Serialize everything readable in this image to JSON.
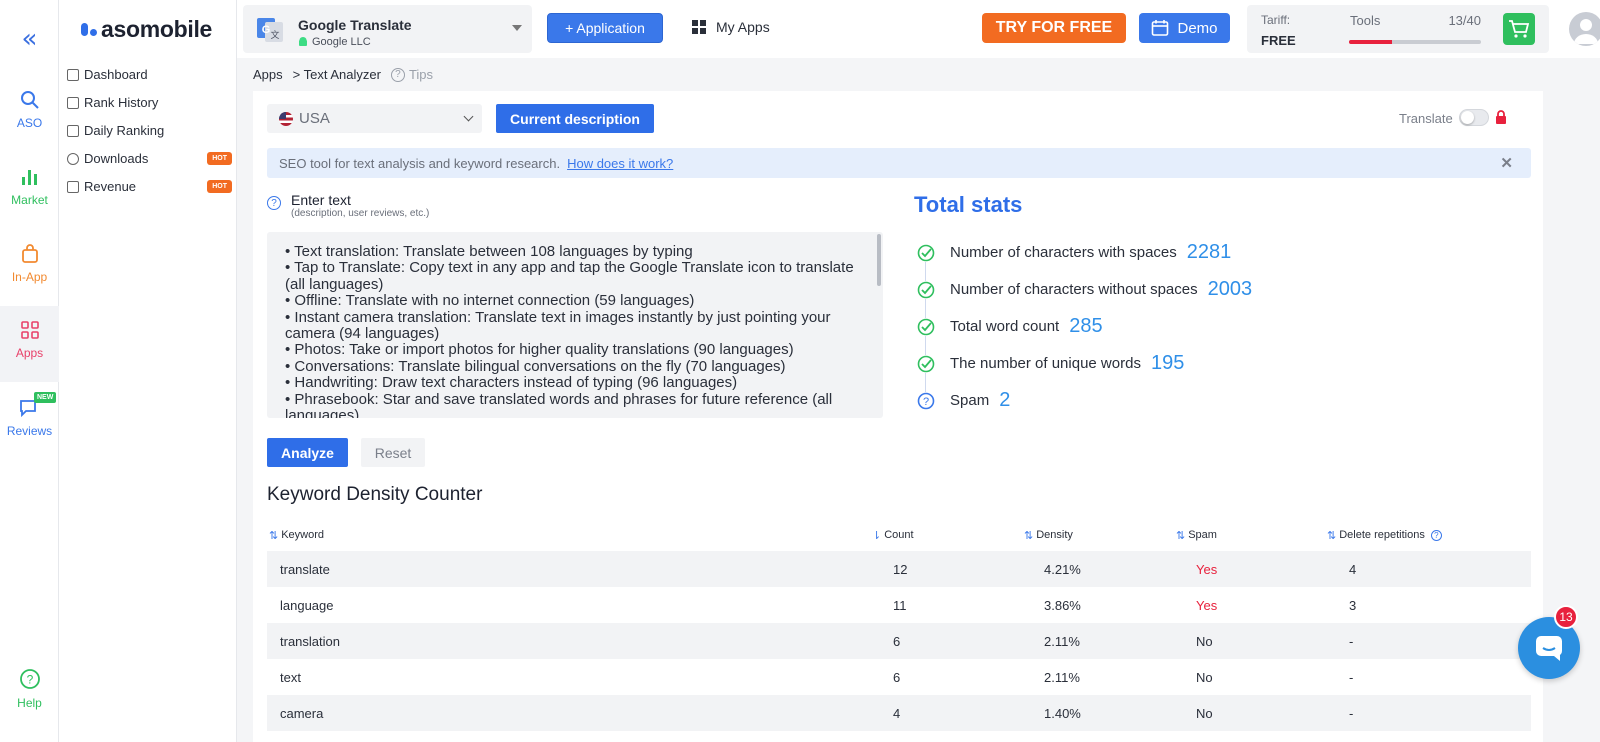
{
  "rail": {
    "items": [
      {
        "label": "ASO",
        "icon": "search-icon",
        "color": "#3a78ea"
      },
      {
        "label": "Market",
        "icon": "bar-chart-icon",
        "color": "#2fbf5e"
      },
      {
        "label": "In-App",
        "icon": "shopping-bag-icon",
        "color": "#f28a30"
      },
      {
        "label": "Apps",
        "icon": "apps-grid-icon",
        "color": "#e8416a"
      },
      {
        "label": "Reviews",
        "icon": "chat-icon",
        "color": "#3a78ea",
        "badge": "NEW"
      }
    ],
    "help": "Help"
  },
  "brand": {
    "name": "asomobile"
  },
  "menu": {
    "items": [
      {
        "label": "Dashboard",
        "icon": "dashboard-icon"
      },
      {
        "label": "Rank History",
        "icon": "rank-history-icon"
      },
      {
        "label": "Daily Ranking",
        "icon": "daily-ranking-icon"
      },
      {
        "label": "Downloads",
        "icon": "downloads-icon",
        "badge": "HOT"
      },
      {
        "label": "Revenue",
        "icon": "revenue-icon",
        "badge": "HOT"
      }
    ]
  },
  "topbar": {
    "app_name": "Google Translate",
    "app_developer": "Google LLC",
    "add_app_label": "+ Application",
    "my_apps_label": "My Apps",
    "try_label": "TRY FOR FREE",
    "demo_label": "Demo",
    "tariff_label": "Tariff:",
    "tariff_value": "FREE",
    "tools_label": "Tools",
    "tools_count": "13/40",
    "tools_used": 13,
    "tools_total": 40
  },
  "breadcrumb": {
    "root": "Apps",
    "current": "> Text Analyzer",
    "tips": "Tips"
  },
  "controls": {
    "country": "USA",
    "current_description_label": "Current description",
    "translate_label": "Translate",
    "translate_on": false
  },
  "info": {
    "text": "SEO tool for text analysis and keyword research.",
    "link": "How does it work?"
  },
  "input": {
    "title": "Enter text",
    "subtitle": "(description, user reviews, etc.)",
    "lines": [
      "• Text translation: Translate between 108 languages by typing",
      "• Tap to Translate: Copy text in any app and tap the Google Translate icon to translate (all languages)",
      "• Offline: Translate with no internet connection (59 languages)",
      "• Instant camera translation: Translate text in images instantly by just pointing your camera (94 languages)",
      "• Photos: Take or import photos for higher quality translations (90 languages)",
      "• Conversations: Translate bilingual conversations on the fly (70 languages)",
      "• Handwriting: Draw text characters instead of typing (96 languages)",
      "• Phrasebook: Star and save translated words and phrases for future reference (all languages)"
    ],
    "analyze_label": "Analyze",
    "reset_label": "Reset"
  },
  "stats": {
    "title": "Total stats",
    "items": [
      {
        "label": "Number of characters with spaces",
        "value": "2281",
        "icon": "check-circle-icon"
      },
      {
        "label": "Number of characters without spaces",
        "value": "2003",
        "icon": "check-circle-icon"
      },
      {
        "label": "Total word count",
        "value": "285",
        "icon": "check-circle-icon"
      },
      {
        "label": "The number of unique words",
        "value": "195",
        "icon": "check-circle-icon"
      },
      {
        "label": "Spam",
        "value": "2",
        "icon": "question-circle-icon"
      }
    ]
  },
  "density": {
    "title": "Keyword Density Counter",
    "columns": [
      "Keyword",
      "Count",
      "Density",
      "Spam",
      "Delete repetitions"
    ],
    "rows": [
      {
        "keyword": "translate",
        "count": "12",
        "density": "4.21%",
        "spam": "Yes",
        "delete": "4"
      },
      {
        "keyword": "language",
        "count": "11",
        "density": "3.86%",
        "spam": "Yes",
        "delete": "3"
      },
      {
        "keyword": "translation",
        "count": "6",
        "density": "2.11%",
        "spam": "No",
        "delete": "-"
      },
      {
        "keyword": "text",
        "count": "6",
        "density": "2.11%",
        "spam": "No",
        "delete": "-"
      },
      {
        "keyword": "camera",
        "count": "4",
        "density": "1.40%",
        "spam": "No",
        "delete": "-"
      }
    ]
  },
  "chat": {
    "badge": "13"
  }
}
